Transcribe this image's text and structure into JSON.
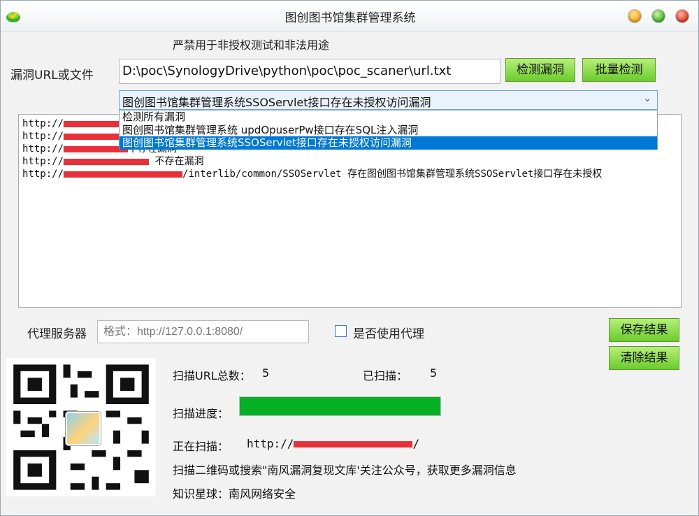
{
  "window": {
    "title": "图创图书馆集群管理系统"
  },
  "warning": "严禁用于非授权测试和非法用途",
  "target": {
    "label": "漏洞URL或文件",
    "value": "D:\\poc\\SynologyDrive\\python\\poc\\poc_scaner\\url.txt",
    "detect_button": "检测漏洞",
    "batch_button": "批量检测"
  },
  "vuln_select": {
    "selected": "图创图书馆集群管理系统SSOServlet接口存在未授权访问漏洞",
    "options": [
      "检测所有漏洞",
      "图创图书馆集群管理系统 updOpuserPw接口存在SQL注入漏洞",
      "图创图书馆集群管理系统SSOServlet接口存在未授权访问漏洞"
    ]
  },
  "results": [
    {
      "prefix": "http://",
      "suffix": ""
    },
    {
      "prefix": "http://",
      "suffix": ""
    },
    {
      "prefix": "http://",
      "suffix": "不存在漏洞"
    },
    {
      "prefix": "http://",
      "suffix": "  不存在漏洞"
    },
    {
      "prefix": "http://",
      "suffix": "/interlib/common/SSOServlet  存在图创图书馆集群管理系统SSOServlet接口存在未授权"
    }
  ],
  "proxy": {
    "label": "代理服务器",
    "placeholder": "格式：http://127.0.0.1:8080/",
    "checkbox_label": "是否使用代理"
  },
  "actions": {
    "save": "保存结果",
    "clear": "清除结果"
  },
  "stats": {
    "total_label": "扫描URL总数：",
    "total": "5",
    "scanned_label": "已扫描：",
    "scanned": "5",
    "progress_label": "扫描进度：",
    "progress_percent": 100,
    "current_label": "正在扫描：",
    "current_prefix": "http://",
    "current_suffix": "/"
  },
  "footer": {
    "qr_hint": "扫描二维码或搜索\"南风漏洞复现文库'关注公众号，获取更多漏洞信息",
    "planet": "知识星球：南风网络安全"
  },
  "colors": {
    "accent_green": "#6bcc2b",
    "progress_green": "#06b025",
    "select_blue": "#0078d7",
    "redact_red": "#e8303a"
  }
}
